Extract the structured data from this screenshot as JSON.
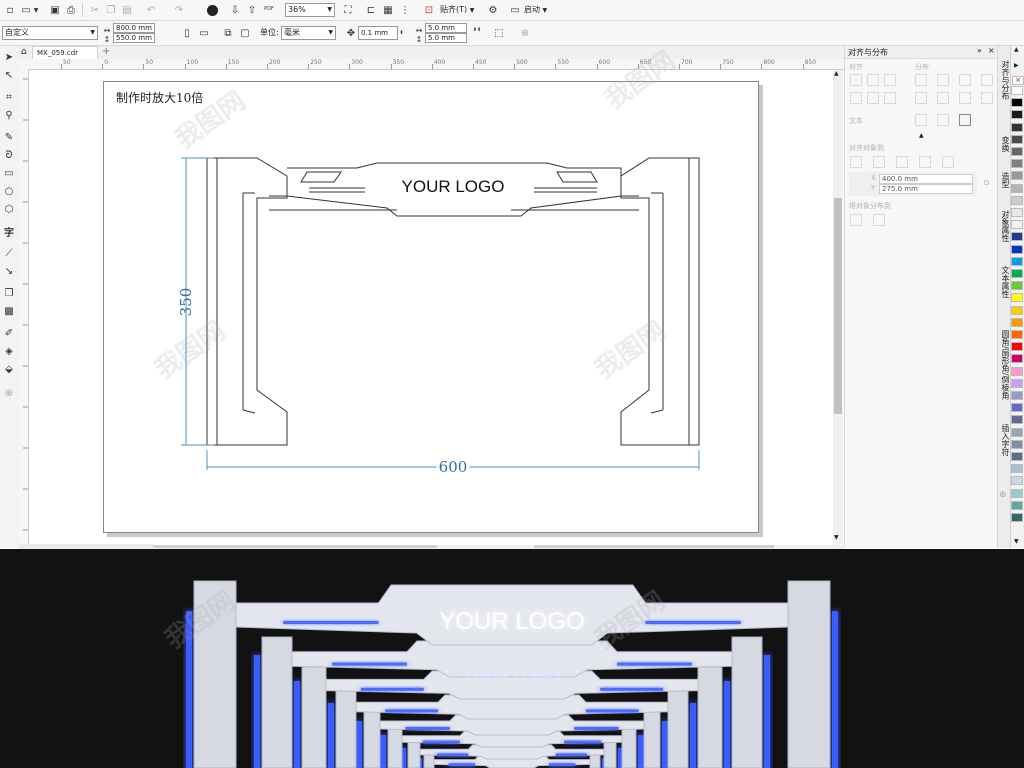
{
  "toolbar": {
    "zoom_value": "36%",
    "snap_label": "贴齐(T)",
    "launch_label": "启动",
    "pdf_label": "PDF"
  },
  "property_bar": {
    "preset_value": "自定义",
    "width_value": "800.0 mm",
    "height_value": "550.0 mm",
    "unit_label": "单位:",
    "unit_value": "毫米",
    "nudge_value": "0.1 mm",
    "dup_x_value": "5.0 mm",
    "dup_y_value": "5.0 mm"
  },
  "document_tab": {
    "filename": "MX_059.cdr"
  },
  "ruler": {
    "ticks": [
      "50",
      "0",
      "50",
      "100",
      "150",
      "200",
      "250",
      "300",
      "350",
      "400",
      "450",
      "500",
      "550",
      "600",
      "650",
      "700",
      "750",
      "800",
      "850"
    ]
  },
  "canvas": {
    "note_text": "制作时放大10倍",
    "logo_text": "YOUR LOGO",
    "height_dimension": "350",
    "width_dimension": "600"
  },
  "align_panel": {
    "title": "对齐与分布",
    "section_align": "对齐",
    "section_distribute": "分布",
    "section_text": "文本",
    "section_align_objects": "对齐对象到",
    "x_value": "400.0 mm",
    "y_value": "275.0 mm",
    "section_spacing": "将对象分布到"
  },
  "dock_tabs": [
    "对齐与分布",
    "变换",
    "造型",
    "对象属性",
    "文本属性",
    "圆角/扇形角/倒棱角",
    "插入字符"
  ],
  "palette_colors": [
    "#ffffff",
    "#000000",
    "#1a1a1a",
    "#333333",
    "#4d4d4d",
    "#666666",
    "#808080",
    "#999999",
    "#b3b3b3",
    "#cccccc",
    "#e6e6e6",
    "#f2f2f2",
    "#1f3a93",
    "#0033cc",
    "#00a0e9",
    "#00b050",
    "#66cc33",
    "#ffff00",
    "#ffcc00",
    "#ff9900",
    "#ff6600",
    "#ff0000",
    "#cc0066",
    "#ff99cc",
    "#cc99ff",
    "#9999cc",
    "#6666cc",
    "#666699",
    "#99a3b8",
    "#7f8fa6",
    "#5c6f8a",
    "#aac0d8",
    "#c8d8e8",
    "#99cccc",
    "#66a3a3",
    "#336666"
  ],
  "render": {
    "logo_text": "YOUR LOGO",
    "logo_text_back": "YOUR LOGO"
  }
}
